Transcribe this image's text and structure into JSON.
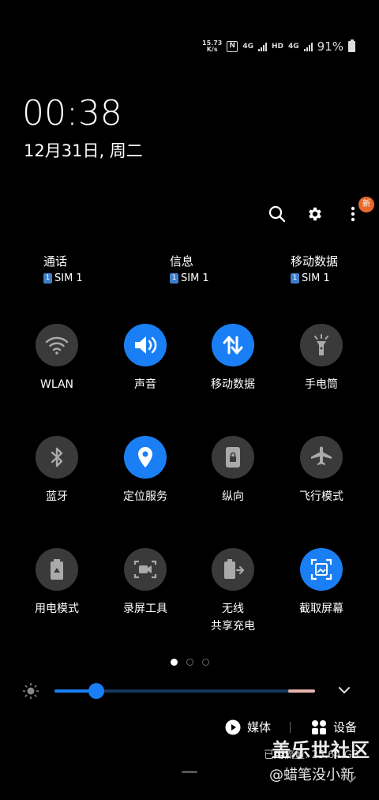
{
  "status": {
    "net_speed_value": "15.73",
    "net_speed_unit": "K/s",
    "nfc": "N",
    "signal1": "4G",
    "hd": "HD",
    "signal2": "4G",
    "battery": "91%"
  },
  "clock": {
    "time": "00:38",
    "date": "12月31日, 周二"
  },
  "toolbar": {
    "new_badge": "新"
  },
  "sims": [
    {
      "title": "通话",
      "sim_num": "1",
      "sim": "SIM 1"
    },
    {
      "title": "信息",
      "sim_num": "1",
      "sim": "SIM 1"
    },
    {
      "title": "移动数据",
      "sim_num": "1",
      "sim": "SIM 1"
    }
  ],
  "tiles": [
    {
      "label": "WLAN",
      "icon": "wifi-icon",
      "active": false
    },
    {
      "label": "声音",
      "icon": "sound-icon",
      "active": true
    },
    {
      "label": "移动数据",
      "icon": "mobile-data-icon",
      "active": true
    },
    {
      "label": "手电筒",
      "icon": "flashlight-icon",
      "active": false
    },
    {
      "label": "蓝牙",
      "icon": "bluetooth-icon",
      "active": false
    },
    {
      "label": "定位服务",
      "icon": "location-icon",
      "active": true
    },
    {
      "label": "纵向",
      "icon": "rotation-lock-icon",
      "active": false
    },
    {
      "label": "飞行模式",
      "icon": "airplane-icon",
      "active": false
    },
    {
      "label": "用电模式",
      "icon": "battery-mode-icon",
      "active": false
    },
    {
      "label": "录屏工具",
      "icon": "screen-record-icon",
      "active": false
    },
    {
      "label_line1": "无线",
      "label_line2": "共享充电",
      "icon": "wireless-powershare-icon",
      "active": false
    },
    {
      "label": "截取屏幕",
      "icon": "screenshot-icon",
      "active": true
    }
  ],
  "pager": {
    "pages": 3,
    "active": 0
  },
  "brightness": {
    "level": 0.16,
    "warning_from": 0.9
  },
  "media": {
    "media_label": "媒体",
    "devices_label": "设备"
  },
  "data_usage": "已用流量: 25.64 GB",
  "watermark": {
    "line1": "盖乐世社区",
    "line2": "@蜡笔没小新"
  },
  "colors": {
    "accent": "#1a7ff5",
    "tile_off": "#3a3a3a",
    "badge": "#e86a2b"
  }
}
